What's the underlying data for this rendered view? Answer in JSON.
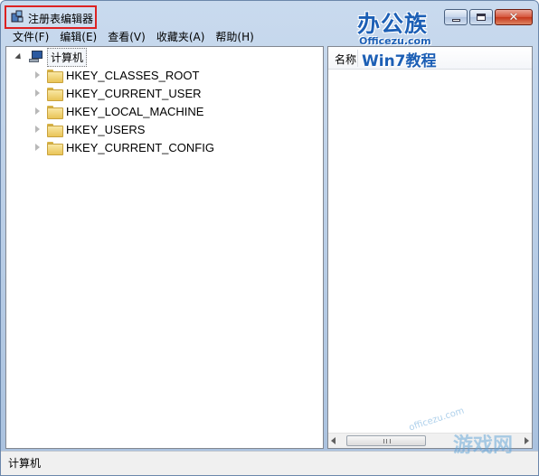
{
  "window": {
    "title": "注册表编辑器",
    "watermark_main": "办公族",
    "watermark_sub": "Officezu.com",
    "close_glyph": "✕"
  },
  "menu": [
    {
      "label": "文件(F)"
    },
    {
      "label": "编辑(E)"
    },
    {
      "label": "查看(V)"
    },
    {
      "label": "收藏夹(A)"
    },
    {
      "label": "帮助(H)"
    }
  ],
  "tree": {
    "root": "计算机",
    "keys": [
      {
        "label": "HKEY_CLASSES_ROOT"
      },
      {
        "label": "HKEY_CURRENT_USER"
      },
      {
        "label": "HKEY_LOCAL_MACHINE"
      },
      {
        "label": "HKEY_USERS"
      },
      {
        "label": "HKEY_CURRENT_CONFIG"
      }
    ]
  },
  "list": {
    "column_name": "名称",
    "watermark": "Win7教程"
  },
  "status": {
    "path": "计算机"
  },
  "corner_watermark": {
    "text": "游戏网",
    "url": "officezu.com"
  },
  "icons": {
    "app": "regedit-icon",
    "root": "computer-icon",
    "key": "folder-icon"
  }
}
